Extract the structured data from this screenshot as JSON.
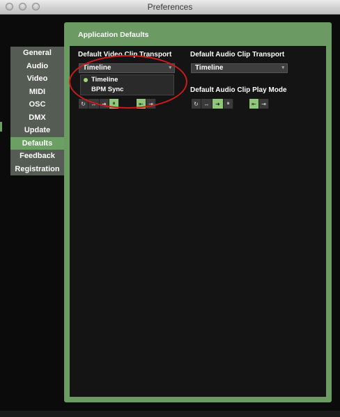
{
  "window": {
    "title": "Preferences"
  },
  "sidebar": {
    "items": [
      {
        "label": "General"
      },
      {
        "label": "Audio"
      },
      {
        "label": "Video"
      },
      {
        "label": "MIDI"
      },
      {
        "label": "OSC"
      },
      {
        "label": "DMX"
      },
      {
        "label": "Update"
      },
      {
        "label": "Defaults",
        "active": true
      },
      {
        "label": "Feedback"
      },
      {
        "label": "Registration"
      }
    ]
  },
  "panel": {
    "title": "Application Defaults",
    "video_transport": {
      "label": "Default Video Clip Transport",
      "value": "Timeline"
    },
    "audio_transport": {
      "label": "Default Audio Clip Transport",
      "value": "Timeline"
    },
    "audio_play_mode": {
      "label": "Default Audio Clip Play Mode"
    },
    "dropdown": {
      "options": [
        {
          "label": "Timeline",
          "selected": true
        },
        {
          "label": "BPM Sync"
        }
      ]
    }
  },
  "icons": {
    "loop": "↻",
    "bounce": "↔",
    "forward": "➜",
    "pause": "⏸",
    "first_frame": "⇤",
    "last_frame": "⇥",
    "arrow_down": "▾"
  },
  "colors": {
    "panel_green": "#6b9a63",
    "active_green": "#6aa061",
    "button_on": "#8fc878",
    "annotation_red": "#d01a1a"
  }
}
